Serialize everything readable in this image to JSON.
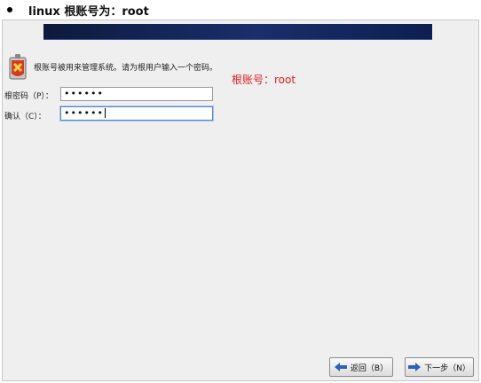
{
  "doc": {
    "heading": "linux 根账号为：root"
  },
  "dialog": {
    "description": "根账号被用来管理系统。请为根用户输入一个密码。",
    "annotation": "根账号：root",
    "fields": [
      {
        "label": "根密码（P）：",
        "value": "••••••"
      },
      {
        "label": "确认（C）：",
        "value": "••••••"
      }
    ],
    "buttons": {
      "back": "返回（B）",
      "next": "下一步（N）"
    }
  },
  "colors": {
    "banner": "#1a2e6b",
    "annotation": "#e02020",
    "button_arrow": "#2b63b8"
  },
  "icons": {
    "root_icon": "shield-x-icon",
    "back_icon": "arrow-left-icon",
    "next_icon": "arrow-right-icon"
  }
}
